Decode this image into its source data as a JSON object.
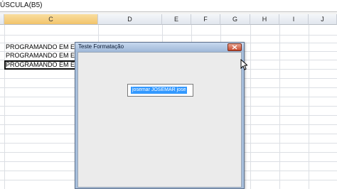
{
  "formula_bar": {
    "text": "ÚSCULA(B5)"
  },
  "columns": [
    "C",
    "D",
    "E",
    "F",
    "G",
    "H",
    "I",
    "J"
  ],
  "cells": [
    "PROGRAMANDO EM EXCEL",
    "PROGRAMANDO EM EXCEL",
    "PROGRAMANDO EM EXCEL"
  ],
  "dialog": {
    "title": "Teste Formatação",
    "textbox_value": "josemar JOSEMAR jose"
  },
  "colors": {
    "selected_header": "#f2c36b",
    "selection": "#3399ff",
    "close_button": "#c64a2f"
  }
}
